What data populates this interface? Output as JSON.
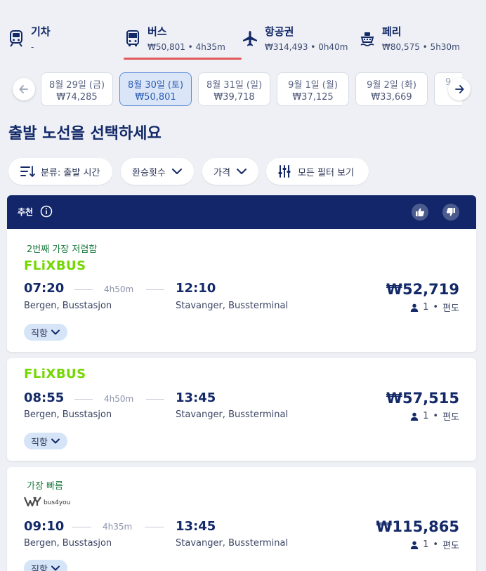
{
  "modes": [
    {
      "name": "기차",
      "sub": "-",
      "icon": "train-icon"
    },
    {
      "name": "버스",
      "sub": "₩50,801 • 4h35m",
      "icon": "bus-icon"
    },
    {
      "name": "항공권",
      "sub": "₩314,493 • 0h40m",
      "icon": "plane-icon"
    },
    {
      "name": "페리",
      "sub": "₩80,575 • 5h30m",
      "icon": "ferry-icon"
    }
  ],
  "active_mode": "버스",
  "dates": [
    {
      "label": "8월 29일 (금)",
      "price": "₩74,285"
    },
    {
      "label": "8월 30일 (토)",
      "price": "₩50,801"
    },
    {
      "label": "8월 31일 (일)",
      "price": "₩39,718"
    },
    {
      "label": "9월 1일 (월)",
      "price": "₩37,125"
    },
    {
      "label": "9월 2일 (화)",
      "price": "₩33,669"
    },
    {
      "label": "9",
      "price": ""
    }
  ],
  "selected_date": "8월 30일 (토)",
  "page_title": "출발 노선을 선택하세요",
  "filters": {
    "sort": "분류: 출발 시간",
    "transfers": "환승횟수",
    "price": "가격",
    "all": "모든 필터 보기"
  },
  "recommended": {
    "label": "추천"
  },
  "results": [
    {
      "tag": "2번째 가장 저렴함",
      "operator": "FLiXBUS",
      "depart_time": "07:20",
      "duration": "4h50m",
      "arrive_time": "12:10",
      "depart_station": "Bergen, Busstasjon",
      "arrive_station": "Stavanger, Bussterminal",
      "price": "₩52,719",
      "pax": "1",
      "trip": "편도",
      "route_type": "직항"
    },
    {
      "tag": "",
      "operator": "FLiXBUS",
      "depart_time": "08:55",
      "duration": "4h50m",
      "arrive_time": "13:45",
      "depart_station": "Bergen, Busstasjon",
      "arrive_station": "Stavanger, Bussterminal",
      "price": "₩57,515",
      "pax": "1",
      "trip": "편도",
      "route_type": "직항"
    },
    {
      "tag": "가장 빠름",
      "operator": "bus4you",
      "depart_time": "09:10",
      "duration": "4h35m",
      "arrive_time": "13:45",
      "depart_station": "Bergen, Busstasjon",
      "arrive_station": "Stavanger, Bussterminal",
      "price": "₩115,865",
      "pax": "1",
      "trip": "편도",
      "route_type": "직항"
    }
  ],
  "colors": {
    "navy": "#132968",
    "accent_underline": "#e35a5a",
    "tag_green": "#1b7a3f",
    "flixbus_green": "#73d700",
    "chip_bg": "#d5e4f7",
    "selected_date_bg": "#dae6f8"
  }
}
